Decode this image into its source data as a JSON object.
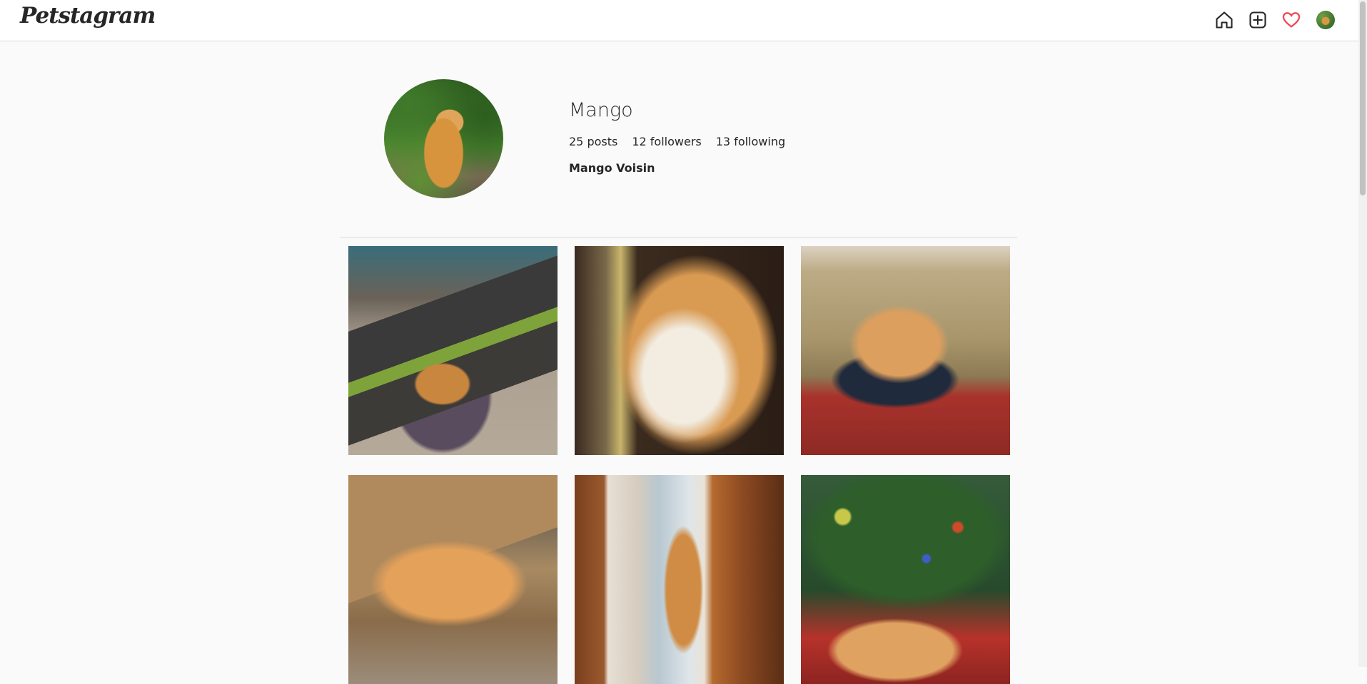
{
  "app": {
    "name": "Petstagram"
  },
  "nav": {
    "icons": [
      "home-icon",
      "new-post-icon",
      "heart-icon",
      "profile-avatar"
    ],
    "heart_color": "#ed4956"
  },
  "profile": {
    "username": "Mango",
    "posts": "25 posts",
    "followers": "12 followers",
    "following": "13 following",
    "full_name": "Mango Voisin"
  },
  "posts": [
    {
      "description": "cat inside a witch-hat cardboard house"
    },
    {
      "description": "orange and white cat in sunlight by window"
    },
    {
      "description": "orange cat sleeping on couch"
    },
    {
      "description": "orange cat lying in cardboard box"
    },
    {
      "description": "cat standing at glass door"
    },
    {
      "description": "orange cat under christmas tree"
    }
  ]
}
